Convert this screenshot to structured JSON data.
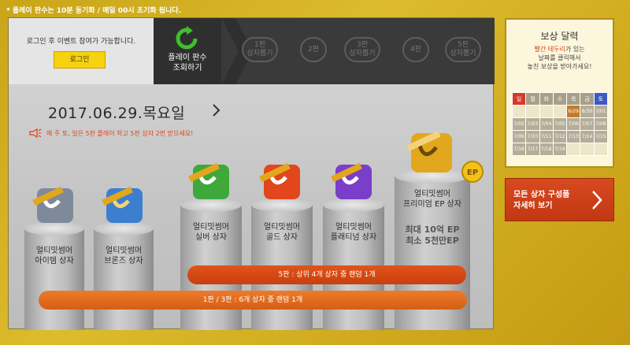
{
  "notice": "* 플레이 판수는 10분 동기화 / 매일 00시 초기화 됩니다.",
  "login": {
    "message": "로그인 후 이벤트 참여가 가능합니다.",
    "button": "로그인"
  },
  "refresh": {
    "label": "플레이 판수\n조회하기",
    "icon": "refresh-arrow-icon"
  },
  "steps": [
    {
      "label": "1판\n상자뽑기"
    },
    {
      "label": "2판"
    },
    {
      "label": "3판\n상자뽑기"
    },
    {
      "label": "4판"
    },
    {
      "label": "5판\n상자뽑기"
    }
  ],
  "date": "2017.06.29.목요일",
  "promo": "매 주 토, 일은 5판 플레이 하고 5판 상자 2번 받으세요!",
  "boxes": [
    {
      "label": "얼티밋썸머\n아이템 상자",
      "color": "#7e8a99"
    },
    {
      "label": "얼티밋썸머\n브론즈 상자",
      "color": "#3c7fd0"
    },
    {
      "label": "얼티밋썸머\n실버 상자",
      "color": "#3fa83a"
    },
    {
      "label": "얼티밋썸머\n골드 상자",
      "color": "#e2461d"
    },
    {
      "label": "얼티밋썸머\n플래티넘 상자",
      "color": "#7a3ec9"
    },
    {
      "label": "얼티밋썸머\n프리미엄 EP 상자",
      "color": "#e2a71d"
    }
  ],
  "premium": {
    "prize": "최대 10억 EP\n최소 5천만EP",
    "badge": "EP"
  },
  "bars": {
    "five": "5판 : 상위 4개 상자 중 랜덤 1개",
    "one_three": "1판 / 3판 : 6개 상자 중 랜덤 1개"
  },
  "reward": {
    "title": "보상 달력",
    "desc_red": "빨간 테두리",
    "desc_rest1": "가 있는",
    "desc_line2": "날짜를 클릭해서",
    "desc_line3": "놓친 보상을 받아가세요!",
    "weekdays": [
      "일",
      "월",
      "화",
      "수",
      "목",
      "금",
      "토"
    ],
    "rows": [
      [
        "",
        "",
        "",
        "",
        "6/29",
        "6/30",
        "7/01"
      ],
      [
        "7/02",
        "7/03",
        "7/04",
        "7/05",
        "7/06",
        "7/07",
        "7/08"
      ],
      [
        "7/09",
        "7/10",
        "7/11",
        "7/12",
        "7/13",
        "7/14",
        "7/15"
      ],
      [
        "7/16",
        "7/17",
        "7/18",
        "7/19",
        "",
        "",
        ""
      ]
    ]
  },
  "all_boxes": {
    "label": "모든 상자 구성품\n자세히 보기"
  },
  "colors": {
    "accent": "#e0461a",
    "login_button": "#f6d20f",
    "refresh_green": "#3fbf2a"
  }
}
